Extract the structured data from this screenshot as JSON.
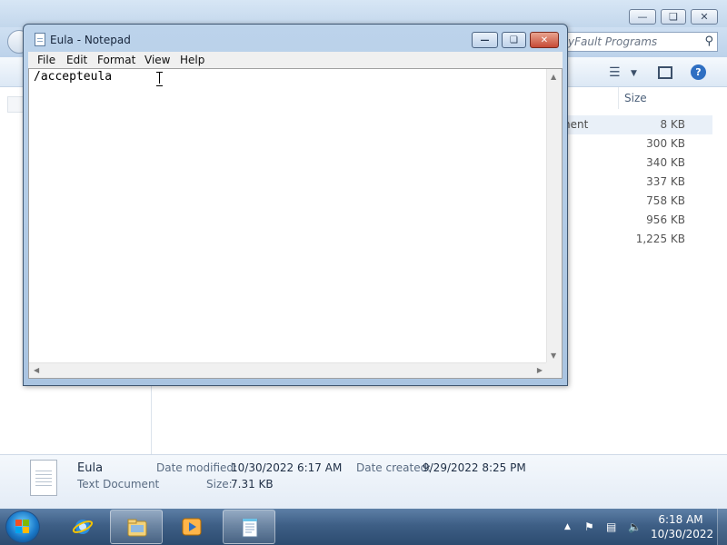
{
  "explorer": {
    "search_placeholder": "yFault Programs",
    "column_size": "Size",
    "rows": [
      {
        "type": "nent",
        "size": "8 KB"
      },
      {
        "type": "",
        "size": "300 KB"
      },
      {
        "type": "",
        "size": "340 KB"
      },
      {
        "type": "",
        "size": "337 KB"
      },
      {
        "type": "",
        "size": "758 KB"
      },
      {
        "type": "",
        "size": "956 KB"
      },
      {
        "type": "",
        "size": "1,225 KB"
      }
    ],
    "details": {
      "name": "Eula",
      "file_type": "Text Document",
      "date_modified_label": "Date modified:",
      "date_modified": "10/30/2022 6:17 AM",
      "size_label": "Size:",
      "size": "7.31 KB",
      "date_created_label": "Date created:",
      "date_created": "9/29/2022 8:25 PM"
    }
  },
  "notepad": {
    "title": "Eula - Notepad",
    "menu": [
      "File",
      "Edit",
      "Format",
      "View",
      "Help"
    ],
    "content": "/accepteula"
  },
  "taskbar": {
    "time": "6:18 AM",
    "date": "10/30/2022",
    "pinned": [
      "internet-explorer",
      "windows-explorer",
      "media-player",
      "notepad"
    ]
  },
  "colors": {
    "taskbar": "#3e5f86",
    "close_button": "#c74a36",
    "accent": "#2f6fc2"
  }
}
